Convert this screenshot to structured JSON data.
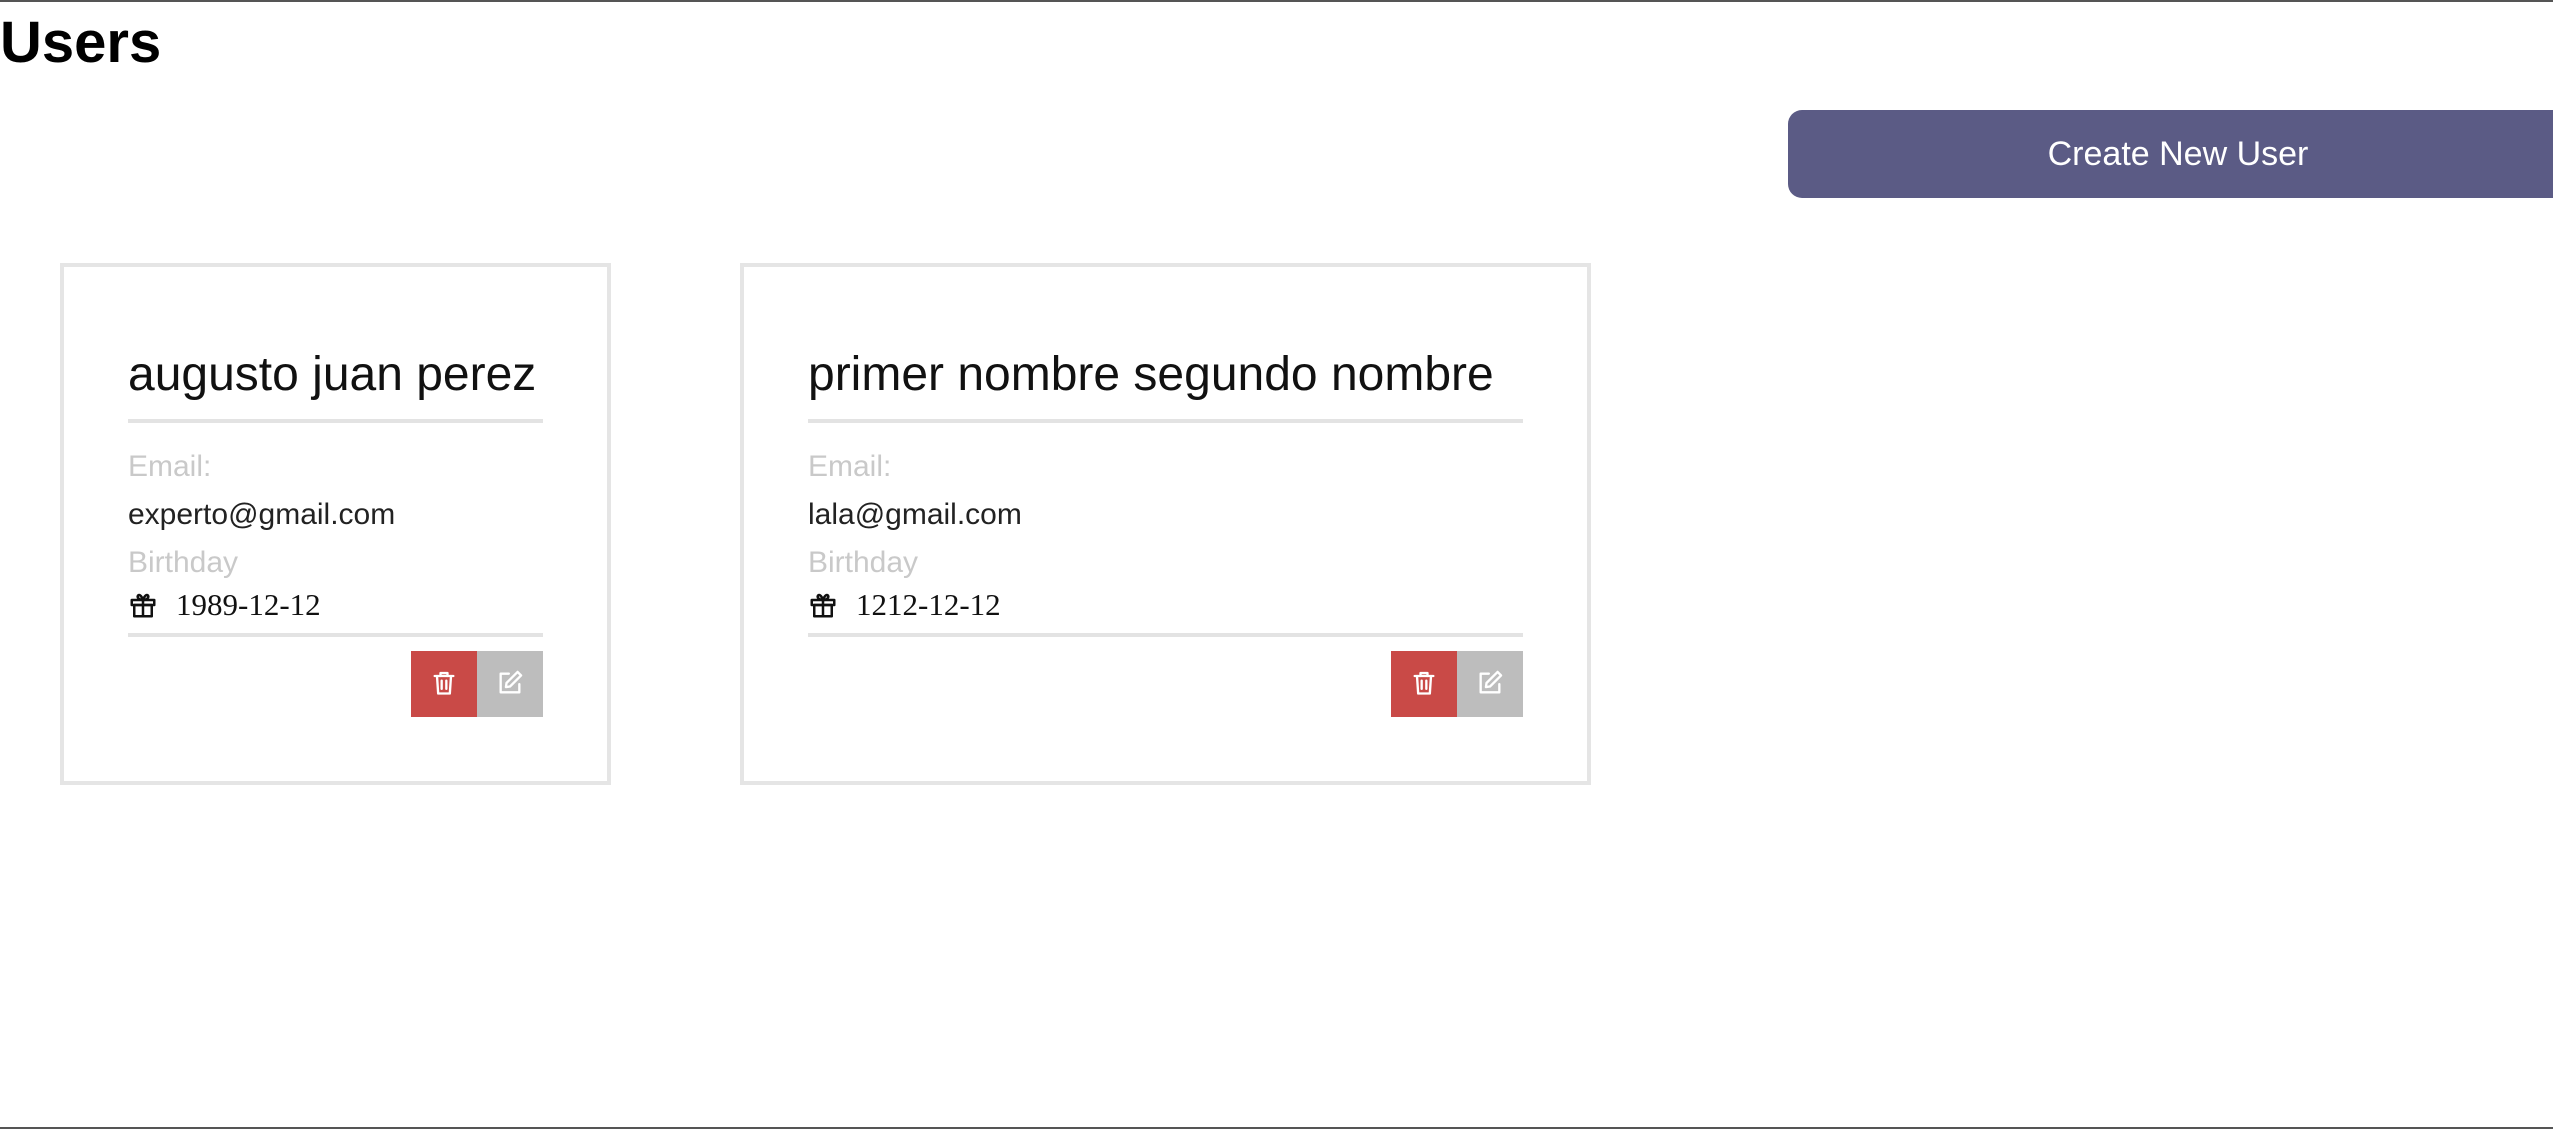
{
  "header": {
    "title": "Users",
    "create_button_label": "Create New User"
  },
  "colors": {
    "primary_button": "#5b5b85",
    "delete_button": "#c94a47",
    "edit_button": "#bdbdbd",
    "card_border": "#e5e5e5",
    "muted_label": "#c9c9c9"
  },
  "icons": {
    "birthday": "gift-icon",
    "delete": "trash-icon",
    "edit": "edit-icon"
  },
  "users": [
    {
      "name": "augusto juan perez",
      "email_label": "Email:",
      "email": "experto@gmail.com",
      "birthday_label": "Birthday",
      "birthday": "1989-12-12"
    },
    {
      "name": "primer nombre segundo nombre",
      "email_label": "Email:",
      "email": "lala@gmail.com",
      "birthday_label": "Birthday",
      "birthday": "1212-12-12"
    }
  ]
}
